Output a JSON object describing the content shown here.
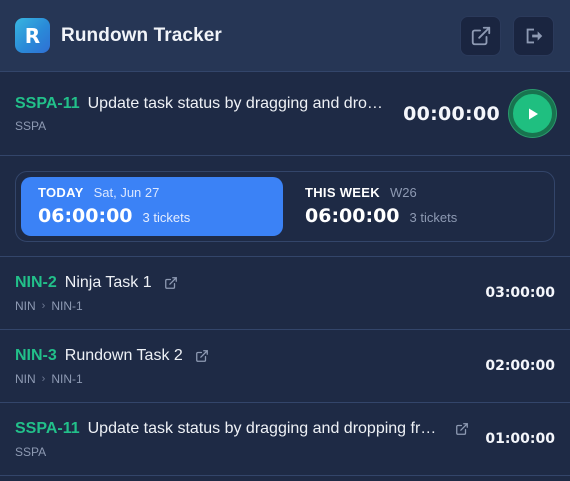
{
  "app": {
    "logo_letter": "R",
    "title": "Rundown Tracker",
    "actions": [
      {
        "icon": "external-link-icon"
      },
      {
        "icon": "logout-icon"
      }
    ]
  },
  "current": {
    "key": "SSPA-11",
    "summary": "Update task status by dragging and droppin...",
    "project": "SSPA",
    "timer": "00:00:00",
    "play_icon": "play-icon"
  },
  "stats": {
    "today": {
      "label": "TODAY",
      "date": "Sat, Jun 27",
      "time": "06:00:00",
      "count": "3 tickets"
    },
    "week": {
      "label": "THIS WEEK",
      "week": "W26",
      "time": "06:00:00",
      "count": "3 tickets"
    }
  },
  "items": [
    {
      "key": "NIN-2",
      "summary": "Ninja Task 1",
      "crumbs": [
        "NIN",
        "NIN-1"
      ],
      "time": "03:00:00"
    },
    {
      "key": "NIN-3",
      "summary": "Rundown Task 2",
      "crumbs": [
        "NIN",
        "NIN-1"
      ],
      "time": "02:00:00"
    },
    {
      "key": "SSPA-11",
      "summary": "Update task status by dragging and dropping from...",
      "crumbs": [
        "SSPA"
      ],
      "time": "01:00:00"
    }
  ],
  "colors": {
    "background": "#1e2a45",
    "header": "#263655",
    "accent_green": "#22c08a",
    "accent_blue": "#3b82f6"
  }
}
